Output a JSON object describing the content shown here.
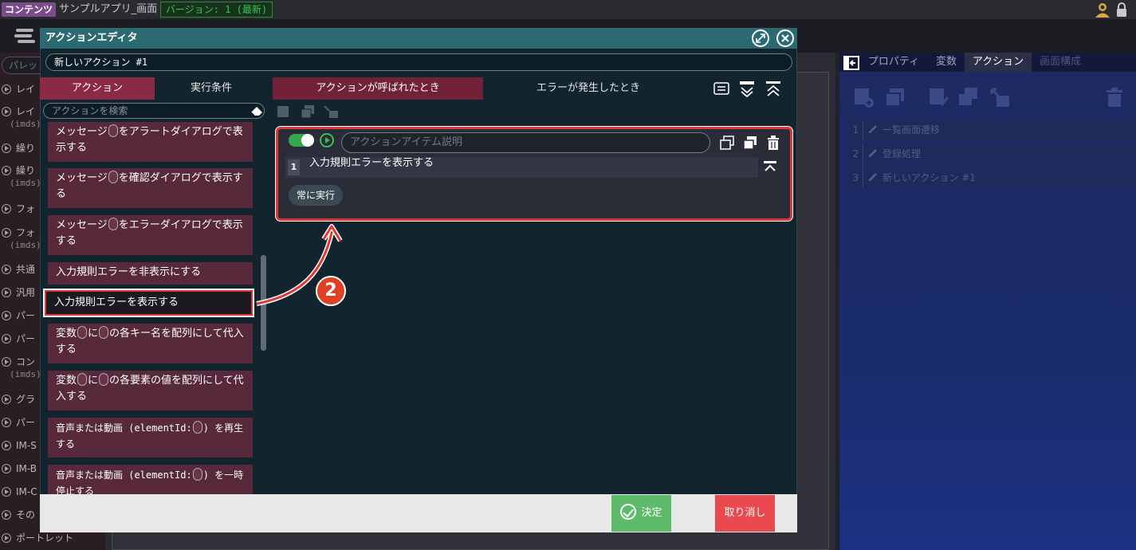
{
  "topbar": {
    "tag": "コンテンツ",
    "app_title": "サンプルアプリ_画面",
    "version": "バージョン: 1 (最新)"
  },
  "palette": {
    "search_placeholder": "パレッ",
    "items": [
      {
        "label": "レイ",
        "sub": ""
      },
      {
        "label": "レイ",
        "sub": "(imds)"
      },
      {
        "label": "繰り",
        "sub": ""
      },
      {
        "label": "繰り",
        "sub": "(imds)"
      },
      {
        "label": "フォ",
        "sub": ""
      },
      {
        "label": "フォ",
        "sub": "(imds)"
      },
      {
        "label": "共通",
        "sub": ""
      },
      {
        "label": "汎用",
        "sub": ""
      },
      {
        "label": "パー",
        "sub": ""
      },
      {
        "label": "パー",
        "sub": ""
      },
      {
        "label": "コン",
        "sub": "(imds)"
      },
      {
        "label": "グラ",
        "sub": ""
      },
      {
        "label": "パー",
        "sub": ""
      },
      {
        "label": "IM-S",
        "sub": ""
      },
      {
        "label": "IM-B",
        "sub": ""
      },
      {
        "label": "IM-C",
        "sub": ""
      },
      {
        "label": "その",
        "sub": ""
      },
      {
        "label": "ポートレット",
        "sub": ""
      }
    ]
  },
  "right_panel": {
    "tabs": [
      "プロパティ",
      "変数",
      "アクション",
      "画面構成"
    ],
    "actions": [
      {
        "num": "1",
        "label": "一覧画面遷移"
      },
      {
        "num": "2",
        "label": "登録処理"
      },
      {
        "num": "3",
        "label": "新しいアクション #1"
      }
    ]
  },
  "modal": {
    "title": "アクションエディタ",
    "action_name": "新しいアクション #1",
    "left_tabs": [
      "アクション",
      "実行条件"
    ],
    "right_tabs": [
      "アクションが呼ばれたとき",
      "エラーが発生したとき"
    ],
    "search_placeholder": "アクションを検索",
    "list_items": [
      {
        "pre": "メッセージ",
        "post": "をアラートダイアログで表示する"
      },
      {
        "pre": "メッセージ",
        "post": "を確認ダイアログで表示する"
      },
      {
        "pre": "メッセージ",
        "post": "をエラーダイアログで表示する"
      },
      {
        "text": "入力規則エラーを非表示にする"
      },
      {
        "text": "入力規則エラーを表示する"
      },
      {
        "a": "変数",
        "b": "に",
        "c": "の各キー名を配列にして代入する"
      },
      {
        "a": "変数",
        "b": "に",
        "c": "の各要素の値を配列にして代入する"
      },
      {
        "pre": "音声または動画 (elementId:",
        "post": ") を再生する"
      },
      {
        "pre": "音声または動画 (elementId:",
        "post": ") を一時停止する"
      }
    ],
    "card": {
      "desc_placeholder": "アクションアイテム説明",
      "row_num": "1",
      "row_label": "入力規則エラーを表示する",
      "condition": "常に実行"
    },
    "footer": {
      "ok": "決定",
      "cancel": "取り消し"
    }
  },
  "annotation": {
    "step": "2"
  },
  "colors": {
    "accent": "#8b2a45",
    "highlight": "#e03838",
    "ok": "#5dbb6a",
    "cancel": "#e84a50"
  }
}
